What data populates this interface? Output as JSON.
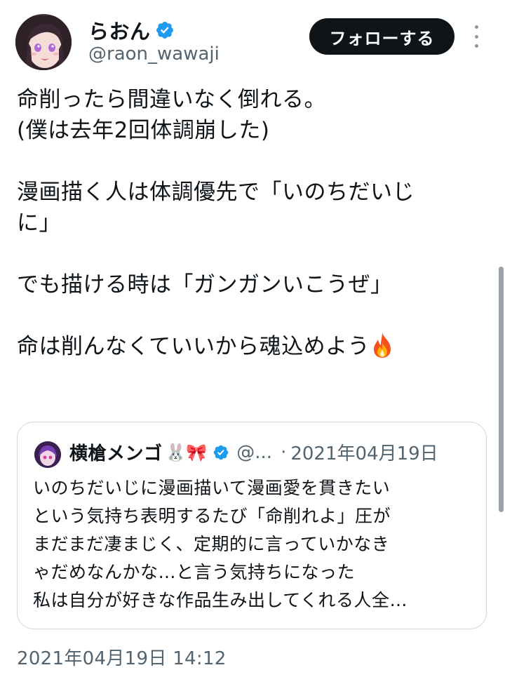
{
  "author": {
    "name": "らおん",
    "handle": "@raon_wawaji",
    "verified": true
  },
  "follow_button": {
    "label": "フォローする"
  },
  "tweet": {
    "lines": [
      "命削ったら間違いなく倒れる。",
      "(僕は去年2回体調崩した)",
      "",
      "漫画描く人は体調優先で「いのちだいじ",
      "に」",
      "",
      "でも描ける時は「ガンガンいこうぜ」",
      "",
      "命は削んなくていいから魂込めよう"
    ],
    "trailing_emoji": "fire-emoji"
  },
  "quoted": {
    "name": "横槍メンゴ",
    "name_emojis": "🐰🎀",
    "verified": true,
    "handle": "@...",
    "separator": "·",
    "date": "2021年04月19日",
    "lines": [
      "いのちだいじに漫画描いて漫画愛を貫きたい",
      "という気持ち表明するたび「命削れよ」圧が",
      "まだまだ凄まじく、定期的に言っていかなき",
      "ゃだめなんかな…と言う気持ちになった",
      "私は自分が好きな作品生み出してくれる人全…"
    ]
  },
  "timestamp": "2021年04月19日 14:12",
  "colors": {
    "text": "#0f1419",
    "secondary": "#536471",
    "verified": "#1d9bf0",
    "follow_bg": "#0f1419",
    "border": "#cfd9de"
  }
}
